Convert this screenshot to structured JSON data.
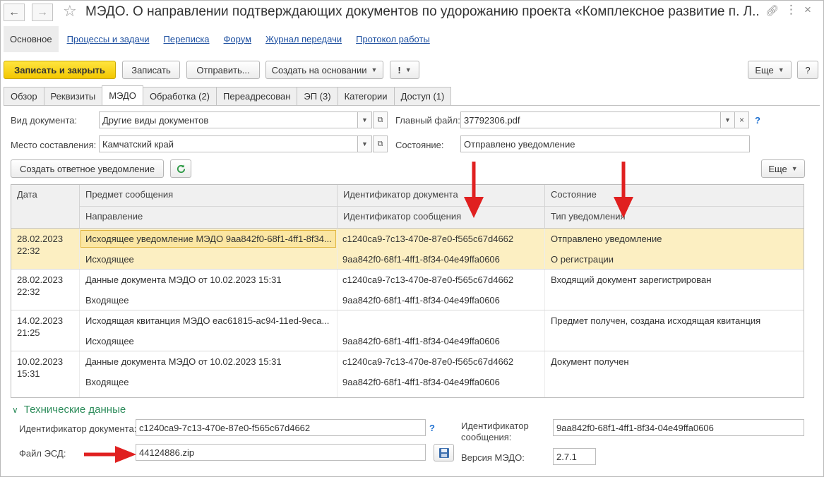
{
  "window": {
    "title": "МЭДО. О направлении подтверждающих документов по удорожанию проекта «Комплексное развитие п. Л..."
  },
  "nav": {
    "active": "Основное",
    "links": [
      "Процессы и задачи",
      "Переписка",
      "Форум",
      "Журнал передачи",
      "Протокол работы"
    ]
  },
  "toolbar": {
    "save_close": "Записать и закрыть",
    "save": "Записать",
    "send": "Отправить...",
    "create_based": "Создать на основании",
    "important": "!",
    "more": "Еще",
    "help": "?"
  },
  "tabs": [
    "Обзор",
    "Реквизиты",
    "МЭДО",
    "Обработка (2)",
    "Переадресован",
    "ЭП (3)",
    "Категории",
    "Доступ (1)"
  ],
  "form": {
    "doc_type_label": "Вид документа:",
    "doc_type_value": "Другие виды документов",
    "place_label": "Место составления:",
    "place_value": "Камчатский край",
    "main_file_label": "Главный файл:",
    "main_file_value": "37792306.pdf",
    "state_label": "Состояние:",
    "state_value": "Отправлено уведомление",
    "create_reply": "Создать ответное уведомление",
    "more": "Еще"
  },
  "table": {
    "headers": {
      "date": "Дата",
      "subject": "Предмет сообщения",
      "direction": "Направление",
      "doc_id": "Идентификатор документа",
      "msg_id": "Идентификатор сообщения",
      "state": "Состояние",
      "notif_type": "Тип уведомления"
    },
    "rows": [
      {
        "date": "28.02.2023",
        "time": "22:32",
        "subject": "Исходящее уведомление МЭДО 9aa842f0-68f1-4ff1-8f34...",
        "direction": "Исходящее",
        "doc_id": "c1240ca9-7c13-470e-87e0-f565c67d4662",
        "msg_id": "9aa842f0-68f1-4ff1-8f34-04e49ffa0606",
        "state": "Отправлено уведомление",
        "notif_type": "О регистрации"
      },
      {
        "date": "28.02.2023",
        "time": "22:32",
        "subject": "Данные документа МЭДО от 10.02.2023 15:31",
        "direction": "Входящее",
        "doc_id": "c1240ca9-7c13-470e-87e0-f565c67d4662",
        "msg_id": "9aa842f0-68f1-4ff1-8f34-04e49ffa0606",
        "state": "Входящий документ зарегистрирован",
        "notif_type": ""
      },
      {
        "date": "14.02.2023",
        "time": "21:25",
        "subject": "Исходящая квитанция МЭДО eac61815-ac94-11ed-9eca...",
        "direction": "Исходящее",
        "doc_id": "",
        "msg_id": "9aa842f0-68f1-4ff1-8f34-04e49ffa0606",
        "state": "Предмет получен, создана исходящая квитанция",
        "notif_type": ""
      },
      {
        "date": "10.02.2023",
        "time": "15:31",
        "subject": "Данные документа МЭДО от 10.02.2023 15:31",
        "direction": "Входящее",
        "doc_id": "c1240ca9-7c13-470e-87e0-f565c67d4662",
        "msg_id": "9aa842f0-68f1-4ff1-8f34-04e49ffa0606",
        "state": "Документ получен",
        "notif_type": ""
      }
    ]
  },
  "tech": {
    "title": "Технические данные",
    "doc_id_label": "Идентификатор документа:",
    "doc_id_value": "c1240ca9-7c13-470e-87e0-f565c67d4662",
    "esd_label": "Файл ЭСД:",
    "esd_value": "44124886.zip",
    "msg_id_label1": "Идентификатор",
    "msg_id_label2": "сообщения:",
    "msg_id_value": "9aa842f0-68f1-4ff1-8f34-04e49ffa0606",
    "version_label": "Версия МЭДО:",
    "version_value": "2.7.1"
  },
  "colors": {
    "accent_link": "#1d4fa0",
    "primary_button": "#f3c700",
    "selected_row": "#fcefc2",
    "arrow": "#e02020",
    "section": "#2d8c5b"
  }
}
